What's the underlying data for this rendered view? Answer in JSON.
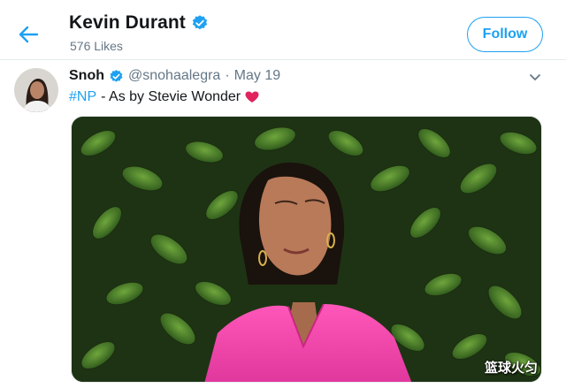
{
  "header": {
    "profile_name": "Kevin Durant",
    "likes": "576 Likes",
    "follow_label": "Follow"
  },
  "tweet": {
    "author_name": "Snoh",
    "handle": "@snohaalegra",
    "separator": "·",
    "date": "May 19",
    "hashtag": "#NP",
    "text": "- As by Stevie Wonder"
  },
  "watermark": "篮球火匀",
  "colors": {
    "accent": "#1da1f2",
    "heart": "#e0245e",
    "muted": "#657786"
  },
  "icons": [
    "back-arrow-icon",
    "verified-badge-icon",
    "chevron-down-icon",
    "heart-icon"
  ]
}
